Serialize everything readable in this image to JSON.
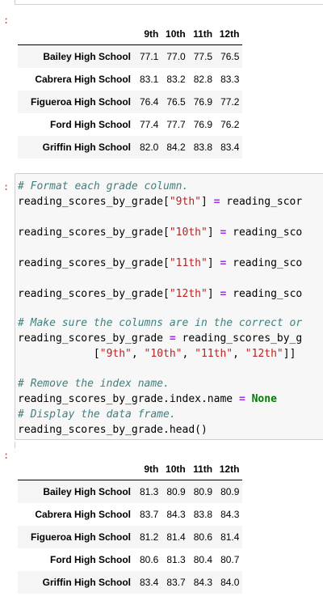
{
  "table1": {
    "columns": [
      "9th",
      "10th",
      "11th",
      "12th"
    ],
    "rows": [
      {
        "school": "Bailey High School",
        "values": [
          "77.1",
          "77.0",
          "77.5",
          "76.5"
        ]
      },
      {
        "school": "Cabrera High School",
        "values": [
          "83.1",
          "83.2",
          "82.8",
          "83.3"
        ]
      },
      {
        "school": "Figueroa High School",
        "values": [
          "76.4",
          "76.5",
          "76.9",
          "77.2"
        ]
      },
      {
        "school": "Ford High School",
        "values": [
          "77.4",
          "77.7",
          "76.9",
          "76.2"
        ]
      },
      {
        "school": "Griffin High School",
        "values": [
          "82.0",
          "84.2",
          "83.8",
          "83.4"
        ]
      }
    ]
  },
  "table2": {
    "columns": [
      "9th",
      "10th",
      "11th",
      "12th"
    ],
    "rows": [
      {
        "school": "Bailey High School",
        "values": [
          "81.3",
          "80.9",
          "80.9",
          "80.9"
        ]
      },
      {
        "school": "Cabrera High School",
        "values": [
          "83.7",
          "84.3",
          "83.8",
          "84.3"
        ]
      },
      {
        "school": "Figueroa High School",
        "values": [
          "81.2",
          "81.4",
          "80.6",
          "81.4"
        ]
      },
      {
        "school": "Ford High School",
        "values": [
          "80.6",
          "81.3",
          "80.4",
          "80.7"
        ]
      },
      {
        "school": "Griffin High School",
        "values": [
          "83.4",
          "83.7",
          "84.3",
          "84.0"
        ]
      }
    ]
  },
  "prompts": [
    ":",
    ":",
    ":"
  ],
  "code": {
    "comment1": "# Format each grade column.",
    "var": "reading_scores_by_grade",
    "lines": [
      {
        "pre": "reading_scores_by_grade[",
        "key": "\"9th\"",
        "post": "] ",
        "op": "=",
        "rest": " reading_scor"
      },
      {
        "pre": "reading_scores_by_grade[",
        "key": "\"10th\"",
        "post": "] ",
        "op": "=",
        "rest": " reading_sco"
      },
      {
        "pre": "reading_scores_by_grade[",
        "key": "\"11th\"",
        "post": "] ",
        "op": "=",
        "rest": " reading_sco"
      },
      {
        "pre": "reading_scores_by_grade[",
        "key": "\"12th\"",
        "post": "] ",
        "op": "=",
        "rest": " reading_sco"
      }
    ],
    "comment2": "# Make sure the columns are in the correct or",
    "reorder_pre": "reading_scores_by_grade ",
    "reorder_op": "=",
    "reorder_rest": " reading_scores_by_g",
    "list_open": "            [",
    "list_items": [
      "\"9th\"",
      "\"10th\"",
      "\"11th\"",
      "\"12th\""
    ],
    "list_sep": ", ",
    "list_close": "]]",
    "comment3": "# Remove the index name.",
    "index_pre": "reading_scores_by_grade.index.name ",
    "index_op": "=",
    "index_kw": "None",
    "comment4": "# Display the data frame.",
    "head_line": "reading_scores_by_grade.head()"
  }
}
